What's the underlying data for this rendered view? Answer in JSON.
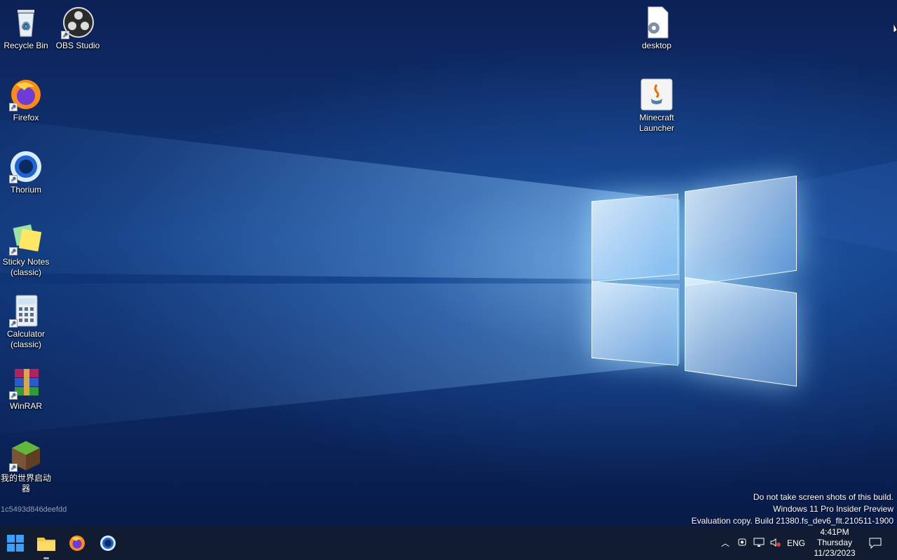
{
  "desktop": {
    "icons": [
      {
        "label": "Recycle Bin"
      },
      {
        "label": "OBS Studio"
      },
      {
        "label": "Firefox"
      },
      {
        "label": "Thorium"
      },
      {
        "label": "Sticky Notes (classic)"
      },
      {
        "label": "Calculator (classic)"
      },
      {
        "label": "WinRAR"
      },
      {
        "label": "我的世界启动器"
      },
      {
        "label": "desktop"
      },
      {
        "label": "Minecraft Launcher"
      }
    ],
    "machine_id": "1c5493d846deefdd"
  },
  "watermark": {
    "line1": "Do not take screen shots of this build.",
    "line2": "Windows 11 Pro Insider Preview",
    "line3": "Evaluation copy. Build 21380.fs_dev6_flt.210511-1900"
  },
  "taskbar": {
    "language": "ENG",
    "time": "4:41PM",
    "day": "Thursday",
    "date": "11/23/2023"
  },
  "colors": {
    "accent": "#0078d4",
    "taskbar": "#121c30"
  }
}
